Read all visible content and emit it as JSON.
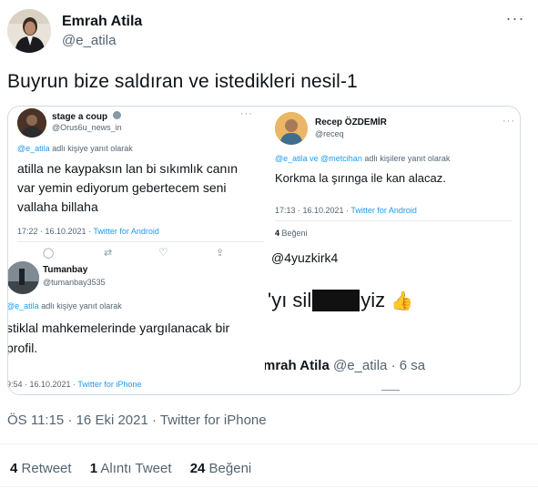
{
  "tweet": {
    "author_name": "Emrah Atila",
    "author_handle": "@e_atila",
    "text": "Buyrun bize saldıran ve istedikleri nesil-1",
    "more_icon": "ellipsis-icon",
    "meta": "ÖS 11:15 · 16 Eki 2021 · Twitter for iPhone",
    "retweets": {
      "count": "4",
      "label": "Retweet"
    },
    "quotes": {
      "count": "1",
      "label": "Alıntı Tweet"
    },
    "likes": {
      "count": "24",
      "label": "Beğeni"
    }
  },
  "media": {
    "shot_a": {
      "name": "stage a coup",
      "handle": "@Orus6u_news_in",
      "reply_to": "@e_atila",
      "reply_suffix": "adlı kişiye yanıt olarak",
      "line1": "atilla ne kaypaksın lan bi sıkımlık canın",
      "line2": "var yemin ediyorum gebertecem seni",
      "line3": "vallaha billaha",
      "time": "17:22 · 16.10.2021 ·",
      "client": "Twitter for Android"
    },
    "shot_b": {
      "name": "Recep ÖZDEMİR",
      "handle": "@receq",
      "reply_to": "@e_atila ve @metcihan",
      "reply_suffix": "adlı kişilere yanıt olarak",
      "body": "Korkma la şırınga ile kan alacaz.",
      "time": "17:13 · 16.10.2021 ·",
      "client": "Twitter for Android",
      "likes_count": "4",
      "likes_label": "Beğeni"
    },
    "shot_c": {
      "name": "Tumanbay",
      "handle": "@tumanbay3535",
      "reply_to": "@e_atila",
      "reply_suffix": "adlı kişiye yanıt olarak",
      "line1": "stiklal mahkemelerinde yargılanacak bir",
      "line2": "profil.",
      "time": "9:54 · 16.10.2021 ·",
      "client": "Twitter for iPhone"
    },
    "shot_d": {
      "handle_line": "@4yuzkirk4",
      "body_start": "'yı sil",
      "body_end": "yiz",
      "emoji": "👍",
      "author": "mrah Atila",
      "author_handle": "@e_atila · 6 sa"
    }
  }
}
